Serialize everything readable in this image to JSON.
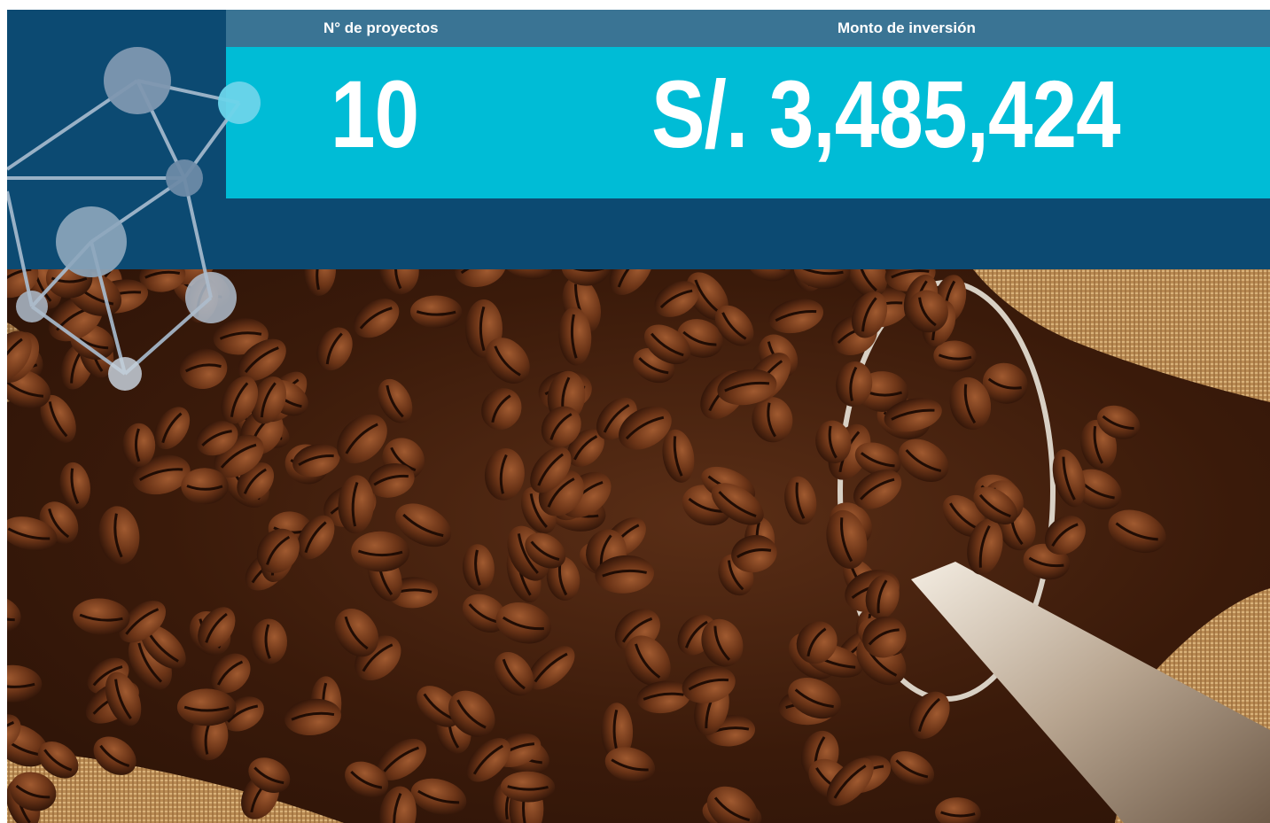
{
  "header": {
    "count_label": "N° de proyectos",
    "amount_label": "Monto de inversión"
  },
  "values": {
    "project_count": "10",
    "investment_amount": "S/. 3,485,424"
  },
  "colors": {
    "dark_blue": "#0c4a72",
    "header_strip": "#3a7494",
    "cyan_band": "#00bcd6"
  },
  "icons": {
    "decoration": "molecule-network-icon"
  },
  "photo": {
    "subject": "coffee-beans-photo"
  }
}
